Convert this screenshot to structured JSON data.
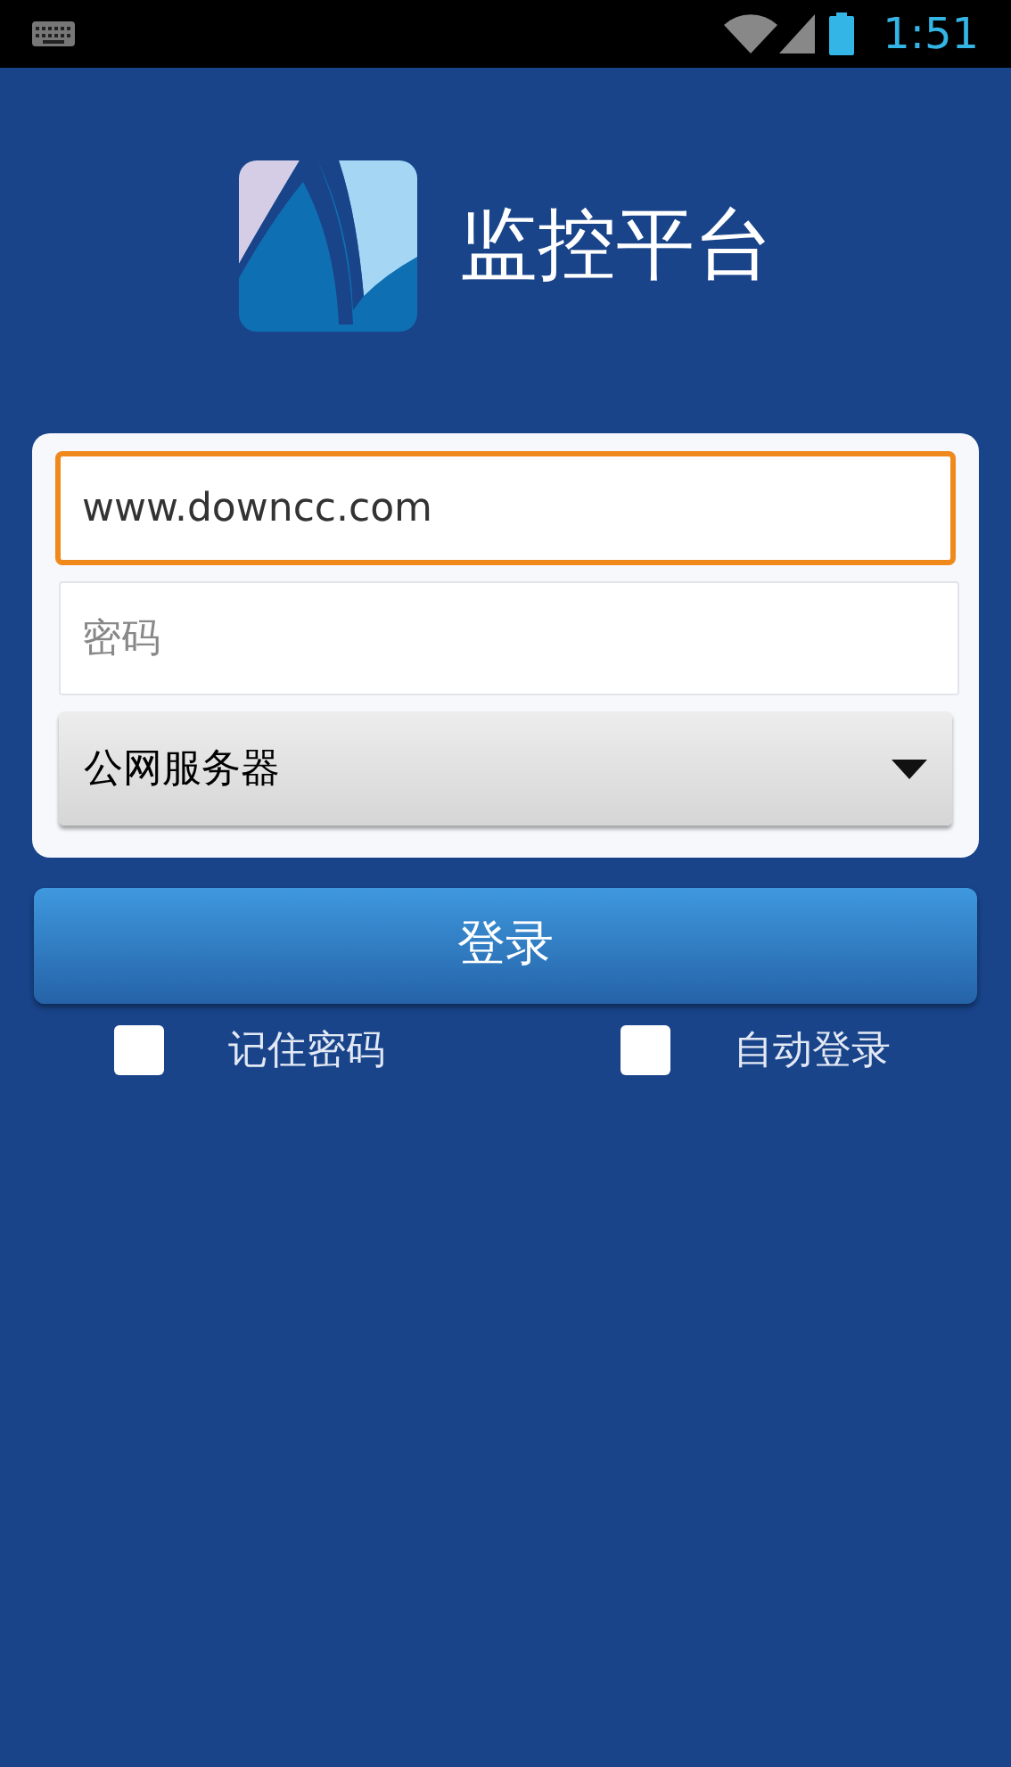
{
  "status_bar": {
    "time": "1:51"
  },
  "header": {
    "title": "监控平台"
  },
  "form": {
    "username": {
      "value": "www.downcc.com",
      "focused": true
    },
    "password": {
      "placeholder": "密码",
      "focused": false
    },
    "server_select": {
      "value": "公网服务器"
    }
  },
  "login_button": {
    "label": "登录"
  },
  "options": [
    {
      "label": "记住密码",
      "checked": false
    },
    {
      "label": "自动登录",
      "checked": false
    }
  ]
}
